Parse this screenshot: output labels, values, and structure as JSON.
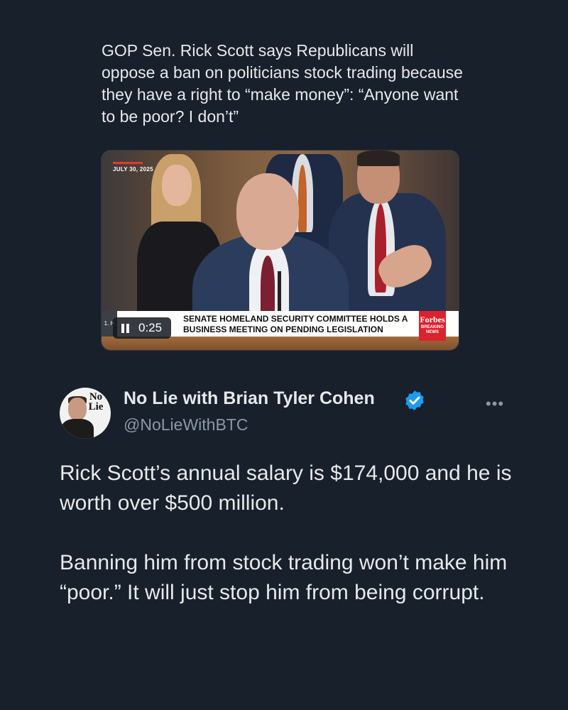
{
  "quoted_tweet": {
    "text": "GOP Sen. Rick Scott says Republicans will oppose a ban on politicians stock trading because they have a right to “make money”: “Anyone want to be poor? I don’t”",
    "video": {
      "date_label": "JULY 30, 2025",
      "lower_third": "SENATE HOMELAND SECURITY COMMITTEE HOLDS A\nBUSINESS MEETING ON PENDING LEGISLATION",
      "left_tag": "1. H",
      "brand": "Forbes",
      "brand_sub": "BREAKING NEWS",
      "duration": "0:25",
      "control_icon": "pause-icon"
    }
  },
  "author": {
    "display_name": "No Lie with Brian Tyler Cohen",
    "handle": "@NoLieWithBTC",
    "avatar_logo": "No Lie",
    "verified_color": "#1d9bf0",
    "more_label": "•••"
  },
  "tweet": {
    "text": "Rick Scott’s annual salary is $174,000 and he is worth over $500 million.\n\nBanning him from stock trading won’t make him “poor.” It will just stop him from being corrupt."
  },
  "colors": {
    "background": "#18202c",
    "text": "#e7e9ea",
    "muted": "#8b98a5"
  }
}
